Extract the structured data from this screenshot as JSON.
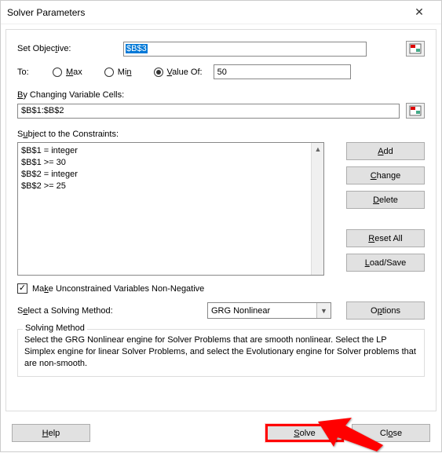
{
  "title": "Solver Parameters",
  "objective": {
    "label_pre": "Set Objec",
    "label_u": "t",
    "label_post": "ive:",
    "value": "$B$3"
  },
  "to": {
    "label": "To:",
    "max_u": "M",
    "max_post": "ax",
    "min_pre": "Mi",
    "min_u": "n",
    "valueof_u": "V",
    "valueof_post": "alue Of:",
    "selected": "valueof",
    "value_input": "50"
  },
  "varcells": {
    "label_u": "B",
    "label_post": "y Changing Variable Cells:",
    "value": "$B$1:$B$2"
  },
  "constraints": {
    "label_pre": "S",
    "label_u": "u",
    "label_post": "bject to the Constraints:",
    "items": [
      "$B$1 = integer",
      "$B$1 >= 30",
      "$B$2 = integer",
      "$B$2 >= 25"
    ]
  },
  "side_buttons": {
    "add_u": "A",
    "add_post": "dd",
    "change_u": "C",
    "change_post": "hange",
    "delete_u": "D",
    "delete_post": "elete",
    "reset_u": "R",
    "reset_post": "eset All",
    "load_u": "L",
    "load_post": "oad/Save"
  },
  "checkbox": {
    "checked": true,
    "pre": "Ma",
    "u": "k",
    "post": "e Unconstrained Variables Non-Negative"
  },
  "method": {
    "label_pre": "S",
    "label_u": "e",
    "label_post": "lect a Solving Method:",
    "selected": "GRG Nonlinear"
  },
  "options": {
    "pre": "O",
    "u": "p",
    "post": "tions"
  },
  "desc": {
    "title": "Solving Method",
    "text": "Select the GRG Nonlinear engine for Solver Problems that are smooth nonlinear. Select the LP Simplex engine for linear Solver Problems, and select the Evolutionary engine for Solver problems that are non-smooth."
  },
  "footer": {
    "help_u": "H",
    "help_post": "elp",
    "solve_u": "S",
    "solve_post": "olve",
    "close_pre": "Cl",
    "close_u": "o",
    "close_post": "se"
  },
  "chart_data": null
}
